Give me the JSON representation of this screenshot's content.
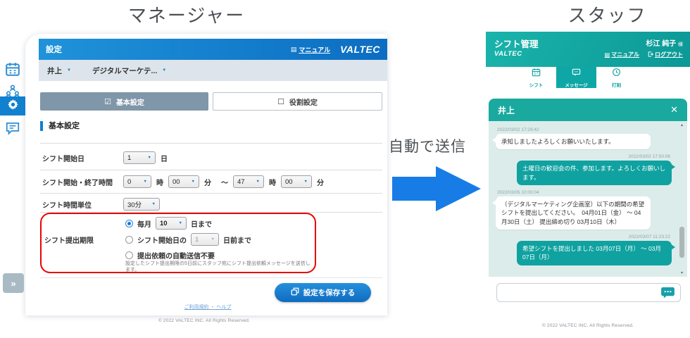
{
  "page": {
    "manager_caption": "マネージャー",
    "staff_caption": "スタッフ",
    "auto_send_label": "自動で送信"
  },
  "manager": {
    "header": {
      "title": "設定",
      "manual_icon": "▤",
      "manual_label": "マニュアル",
      "logo": "VALTEC"
    },
    "toolbar": {
      "user_select": "井上",
      "dept_select": "デジタルマーケテ...",
      "caret": "▼"
    },
    "tabs": {
      "basic_checkbox": "☑",
      "basic_label": "基本設定",
      "role_checkbox": "☐",
      "role_label": "役割設定"
    },
    "section_title": "基本設定",
    "form": {
      "start_day": {
        "label": "シフト開始日",
        "value": "1",
        "unit": "日"
      },
      "time_range": {
        "label": "シフト開始・終了時間",
        "start_hour": "0",
        "hour_unit": "時",
        "start_min": "00",
        "min_unit": "分",
        "tilde": "～",
        "end_hour": "47",
        "end_min": "00"
      },
      "time_unit": {
        "label": "シフト時間単位",
        "value": "30分"
      },
      "deadline": {
        "label": "シフト提出期限",
        "monthly_prefix": "毎月",
        "monthly_value": "10",
        "monthly_suffix": "日まで",
        "before_prefix": "シフト開始日の",
        "before_value": "1",
        "before_suffix": "日前まで",
        "no_auto_label": "提出依頼の自動送信不要",
        "note": "設定したシフト提出期限の5日前にスタッフ宛にシフト提出依頼メッセージを送信します。"
      }
    },
    "save_button": "設定を保存する",
    "footer_links": "ご利用規約 ・ ヘルプ",
    "copyright": "© 2022 VALTEC INC. All Rights Reserved."
  },
  "staff": {
    "header": {
      "title": "シフト管理",
      "logo": "VALTEC",
      "user": "杉江 純子",
      "user_suffix": "様",
      "manual_icon": "▤",
      "manual_label": "マニュアル",
      "logout_label": "ログアウト"
    },
    "tabs": {
      "shift": "シフト",
      "message": "メッセージ",
      "punch": "打刻"
    },
    "chat": {
      "title": "井上",
      "close_icon": "✕",
      "scroll_up_icon": "▴",
      "scroll_down_icon": "▾",
      "messages": [
        {
          "side": "left",
          "time": "2022/03/02 17:29:42",
          "text": "承知しましたよろしくお願いいたします。"
        },
        {
          "side": "right",
          "time": "2022/03/02 17:50:06",
          "text": "土曜日の歓迎会の件、参加します。よろしくお願いします。"
        },
        {
          "side": "left",
          "time": "2022/03/05 10:00:04",
          "text": "（デジタルマーケティング企画室）以下の期間の希望シフトを提出してください。　04月01日（金） ～ 04月30日（土） 提出締め切り 03月10日（木）"
        },
        {
          "side": "right",
          "time": "2022/03/07 11:23:22",
          "text": "希望シフトを提出しました 03月07日（月） ～ 03月07日（月）"
        }
      ]
    },
    "copyright": "© 2022 VALTEC INC. All Rights Reserved."
  },
  "sidebar": {
    "expand_icon": "»"
  },
  "colors": {
    "manager_accent": "#1080cf",
    "staff_accent": "#0fa6a6",
    "annotation_red": "#e60505"
  }
}
